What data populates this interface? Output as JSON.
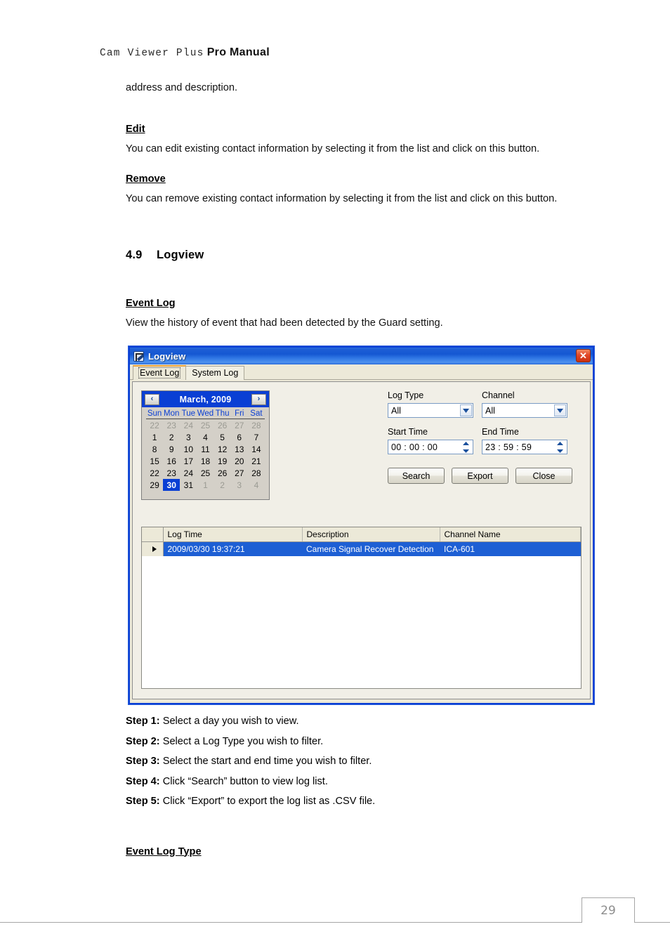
{
  "doc": {
    "header_mono": "Cam Viewer Plus",
    "header_bold": "Pro Manual",
    "intro_line": "address and description.",
    "edit_heading": "Edit",
    "edit_text": "You can edit existing contact information by selecting it from the list and click on this button.",
    "remove_heading": "Remove",
    "remove_text": "You can remove existing contact information by selecting it from the list and click on this button.",
    "section_number": "4.9",
    "section_title": "Logview",
    "event_log_heading": "Event Log",
    "event_log_text": "View the history of event that had been detected by the Guard setting.",
    "event_log_type_heading": "Event Log Type",
    "page_number": "29"
  },
  "steps": [
    {
      "label": "Step 1:",
      "text": " Select a day you wish to view."
    },
    {
      "label": "Step 2:",
      "text": " Select a Log Type you wish to filter."
    },
    {
      "label": "Step 3:",
      "text": " Select the start and end time you wish to filter."
    },
    {
      "label": "Step 4:",
      "text": " Click “Search” button to view log list."
    },
    {
      "label": "Step 5:",
      "text": " Click “Export” to export the log list as .CSV file."
    }
  ],
  "dialog": {
    "title": "Logview",
    "close_label": "✕",
    "tabs": [
      {
        "label": "Event Log",
        "active": true
      },
      {
        "label": "System Log",
        "active": false
      }
    ],
    "calendar": {
      "prev_label": "‹",
      "next_label": "›",
      "title": "March, 2009",
      "weekdays": [
        "Sun",
        "Mon",
        "Tue",
        "Wed",
        "Thu",
        "Fri",
        "Sat"
      ],
      "weeks": [
        [
          {
            "d": "22",
            "o": true
          },
          {
            "d": "23",
            "o": true
          },
          {
            "d": "24",
            "o": true
          },
          {
            "d": "25",
            "o": true
          },
          {
            "d": "26",
            "o": true
          },
          {
            "d": "27",
            "o": true
          },
          {
            "d": "28",
            "o": true
          }
        ],
        [
          {
            "d": "1"
          },
          {
            "d": "2"
          },
          {
            "d": "3"
          },
          {
            "d": "4"
          },
          {
            "d": "5"
          },
          {
            "d": "6"
          },
          {
            "d": "7"
          }
        ],
        [
          {
            "d": "8"
          },
          {
            "d": "9"
          },
          {
            "d": "10"
          },
          {
            "d": "11"
          },
          {
            "d": "12"
          },
          {
            "d": "13"
          },
          {
            "d": "14"
          }
        ],
        [
          {
            "d": "15"
          },
          {
            "d": "16"
          },
          {
            "d": "17"
          },
          {
            "d": "18"
          },
          {
            "d": "19"
          },
          {
            "d": "20"
          },
          {
            "d": "21"
          }
        ],
        [
          {
            "d": "22"
          },
          {
            "d": "23"
          },
          {
            "d": "24"
          },
          {
            "d": "25"
          },
          {
            "d": "26"
          },
          {
            "d": "27"
          },
          {
            "d": "28"
          }
        ],
        [
          {
            "d": "29"
          },
          {
            "d": "30",
            "sel": true
          },
          {
            "d": "31"
          },
          {
            "d": "1",
            "o": true
          },
          {
            "d": "2",
            "o": true
          },
          {
            "d": "3",
            "o": true
          },
          {
            "d": "4",
            "o": true
          }
        ]
      ],
      "selected_day": "30"
    },
    "form": {
      "log_type_label": "Log Type",
      "log_type_value": "All",
      "channel_label": "Channel",
      "channel_value": "All",
      "start_time_label": "Start Time",
      "start_time_value": "00 : 00 : 00",
      "end_time_label": "End Time",
      "end_time_value": "23 : 59 : 59"
    },
    "buttons": {
      "search": "Search",
      "export": "Export",
      "close": "Close"
    },
    "grid": {
      "columns": [
        "Log Time",
        "Description",
        "Channel Name"
      ],
      "rows": [
        {
          "selected": true,
          "log_time": "2009/03/30  19:37:21",
          "description": "Camera Signal Recover Detection",
          "channel_name": "ICA-601"
        }
      ]
    }
  },
  "colors": {
    "titlebar_blue": "#1457d2",
    "selection_blue": "#1d5fd4",
    "dialog_face": "#ece9d8",
    "tab_accent_orange": "#e8a33d",
    "close_red": "#e2472a"
  }
}
